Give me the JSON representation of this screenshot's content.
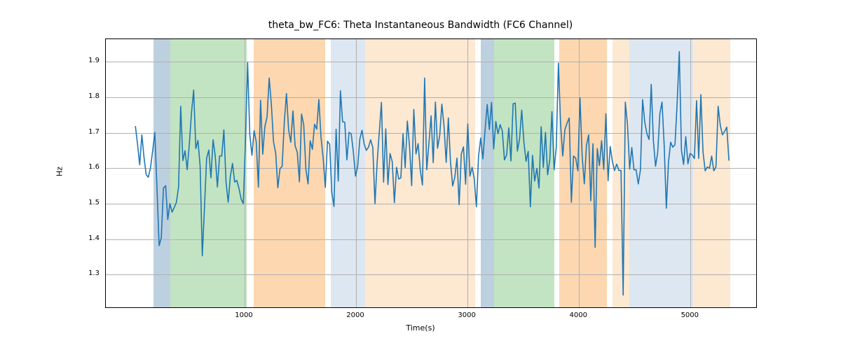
{
  "chart_data": {
    "type": "line",
    "title": "theta_bw_FC6: Theta Instantaneous Bandwidth (FC6 Channel)",
    "xlabel": "Time(s)",
    "ylabel": "Hz",
    "xlim": [
      -244.3,
      5601.5
    ],
    "ylim": [
      1.2042,
      1.9641
    ],
    "xticks": [
      1000,
      2000,
      3000,
      4000,
      5000
    ],
    "yticks": [
      1.3,
      1.4,
      1.5,
      1.6,
      1.7,
      1.8,
      1.9
    ],
    "bands": [
      {
        "start": 180.0,
        "end": 337.0,
        "color": "#bdd0df"
      },
      {
        "start": 337.0,
        "end": 1021.4,
        "color": "#c2e4c2"
      },
      {
        "start": 1079.6,
        "end": 1722.4,
        "color": "#fcd7b0"
      },
      {
        "start": 1775.0,
        "end": 2080.0,
        "color": "#dde7f1"
      },
      {
        "start": 2080.0,
        "end": 2389.2,
        "color": "#fde8d2"
      },
      {
        "start": 2389.2,
        "end": 3068.0,
        "color": "#fde8d2"
      },
      {
        "start": 3116.4,
        "end": 3240.0,
        "color": "#bdd0df"
      },
      {
        "start": 3240.0,
        "end": 3775.6,
        "color": "#c2e4c2"
      },
      {
        "start": 3824.0,
        "end": 4250.0,
        "color": "#fcd7b0"
      },
      {
        "start": 4298.4,
        "end": 4449.8,
        "color": "#fde8d2"
      },
      {
        "start": 4449.8,
        "end": 4521.0,
        "color": "#dde7f1"
      },
      {
        "start": 4521.0,
        "end": 5025.2,
        "color": "#dde7f1"
      },
      {
        "start": 5025.2,
        "end": 5341.8,
        "color": "#fde8d2"
      },
      {
        "start": 5341.8,
        "end": 5357.2,
        "color": "#fde8d2"
      }
    ],
    "series": [
      {
        "name": "theta_bw_FC6",
        "color": "#1f77b4",
        "x_start": 21.4,
        "x_step": 19.4,
        "values": [
          1.718,
          1.666,
          1.608,
          1.693,
          1.629,
          1.58,
          1.573,
          1.6,
          1.647,
          1.7,
          1.542,
          1.379,
          1.401,
          1.542,
          1.549,
          1.453,
          1.498,
          1.474,
          1.487,
          1.502,
          1.545,
          1.774,
          1.62,
          1.648,
          1.594,
          1.667,
          1.756,
          1.82,
          1.654,
          1.677,
          1.604,
          1.35,
          1.485,
          1.627,
          1.65,
          1.571,
          1.679,
          1.633,
          1.545,
          1.633,
          1.633,
          1.707,
          1.559,
          1.502,
          1.575,
          1.612,
          1.559,
          1.564,
          1.541,
          1.511,
          1.498,
          1.676,
          1.898,
          1.695,
          1.635,
          1.705,
          1.673,
          1.545,
          1.791,
          1.638,
          1.717,
          1.743,
          1.854,
          1.779,
          1.673,
          1.642,
          1.543,
          1.597,
          1.604,
          1.73,
          1.81,
          1.707,
          1.672,
          1.761,
          1.662,
          1.644,
          1.56,
          1.752,
          1.721,
          1.595,
          1.554,
          1.676,
          1.652,
          1.723,
          1.709,
          1.793,
          1.687,
          1.627,
          1.544,
          1.675,
          1.666,
          1.53,
          1.49,
          1.709,
          1.562,
          1.818,
          1.73,
          1.729,
          1.622,
          1.7,
          1.696,
          1.644,
          1.576,
          1.604,
          1.681,
          1.706,
          1.667,
          1.649,
          1.658,
          1.679,
          1.657,
          1.498,
          1.614,
          1.7,
          1.785,
          1.559,
          1.71,
          1.552,
          1.64,
          1.617,
          1.501,
          1.601,
          1.568,
          1.571,
          1.696,
          1.6,
          1.732,
          1.662,
          1.549,
          1.765,
          1.639,
          1.668,
          1.593,
          1.551,
          1.854,
          1.594,
          1.669,
          1.747,
          1.614,
          1.786,
          1.655,
          1.691,
          1.78,
          1.718,
          1.615,
          1.741,
          1.616,
          1.548,
          1.573,
          1.627,
          1.495,
          1.638,
          1.659,
          1.553,
          1.724,
          1.576,
          1.601,
          1.569,
          1.489,
          1.633,
          1.684,
          1.625,
          1.705,
          1.779,
          1.708,
          1.785,
          1.653,
          1.731,
          1.696,
          1.722,
          1.704,
          1.622,
          1.636,
          1.713,
          1.619,
          1.781,
          1.783,
          1.647,
          1.682,
          1.763,
          1.673,
          1.618,
          1.646,
          1.489,
          1.635,
          1.562,
          1.598,
          1.542,
          1.716,
          1.601,
          1.7,
          1.58,
          1.622,
          1.759,
          1.594,
          1.658,
          1.896,
          1.724,
          1.633,
          1.708,
          1.726,
          1.741,
          1.502,
          1.633,
          1.627,
          1.591,
          1.798,
          1.633,
          1.554,
          1.664,
          1.693,
          1.506,
          1.668,
          1.374,
          1.654,
          1.606,
          1.676,
          1.595,
          1.753,
          1.563,
          1.66,
          1.617,
          1.592,
          1.61,
          1.592,
          1.592,
          1.239,
          1.786,
          1.723,
          1.596,
          1.657,
          1.594,
          1.594,
          1.554,
          1.594,
          1.793,
          1.729,
          1.696,
          1.68,
          1.836,
          1.676,
          1.604,
          1.643,
          1.753,
          1.786,
          1.664,
          1.485,
          1.616,
          1.672,
          1.658,
          1.665,
          1.782,
          1.929,
          1.649,
          1.609,
          1.688,
          1.611,
          1.64,
          1.636,
          1.626,
          1.79,
          1.626,
          1.807,
          1.644,
          1.591,
          1.602,
          1.598,
          1.633,
          1.591,
          1.602,
          1.774,
          1.72,
          1.693,
          1.703,
          1.715,
          1.62
        ]
      }
    ]
  }
}
